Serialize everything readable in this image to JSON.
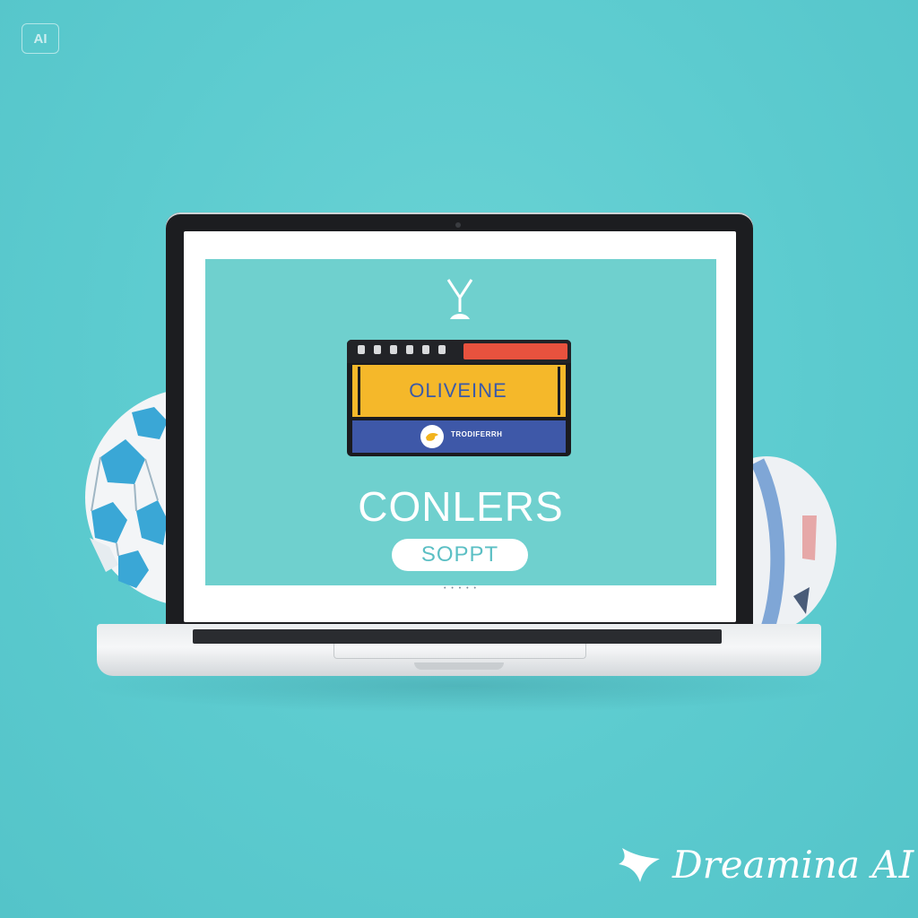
{
  "badge": {
    "label": "AI"
  },
  "screen": {
    "window": {
      "headline": "OLIVEINE",
      "caption": "TRODIFERRH"
    },
    "title": "CONLERS",
    "button_label": "SOPPT",
    "dots": "• • • • •"
  },
  "watermark": {
    "text": "Dreamina AI"
  },
  "colors": {
    "background": "#5ccbcf",
    "screen_bg": "#6fd0ce",
    "window_yellow": "#f5b82a",
    "window_blue": "#3e58a8",
    "window_red": "#e8523e"
  },
  "icons": {
    "logo": "goblet-logo-icon",
    "avatar": "bird-icon",
    "watermark_logo": "dreamina-star-icon"
  }
}
